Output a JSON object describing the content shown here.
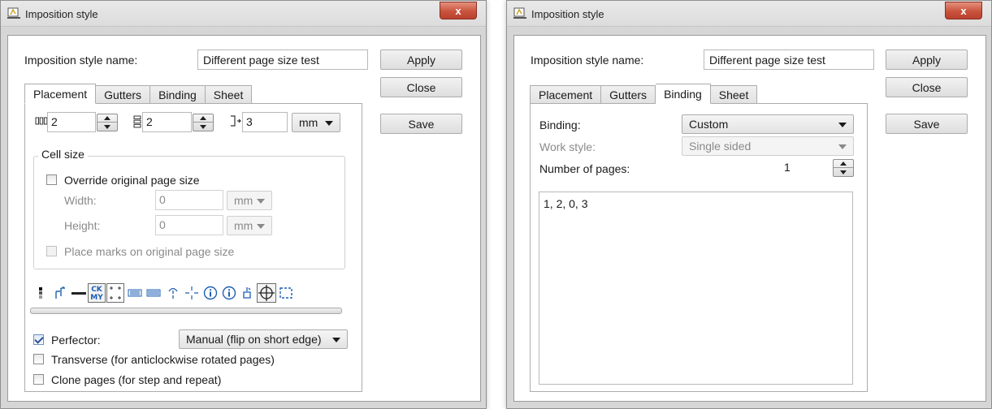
{
  "left_window": {
    "title": "Imposition style",
    "close_glyph": "x",
    "name_label": "Imposition style name:",
    "name_value": "Different page size test",
    "buttons": {
      "apply": "Apply",
      "close": "Close",
      "save": "Save"
    },
    "tabs": [
      "Placement",
      "Gutters",
      "Binding",
      "Sheet"
    ],
    "active_tab": "Placement",
    "placement": {
      "columns_value": "2",
      "rows_value": "2",
      "offset_value": "3",
      "unit": "mm",
      "cell_size": {
        "legend": "Cell size",
        "override_label": "Override original page size",
        "override_checked": false,
        "width_label": "Width:",
        "width_value": "0",
        "width_unit": "mm",
        "height_label": "Height:",
        "height_value": "0",
        "height_unit": "mm",
        "place_marks_label": "Place marks on original page size",
        "place_marks_checked": false
      },
      "mark_icons": [
        "color-bar-icon",
        "crop-marks-icon",
        "dash-line-icon",
        "cmyk-icon",
        "cut-marks-icon",
        "barcode-icon",
        "barcode-2-icon",
        "fold-mark-icon",
        "registration-cross-icon",
        "info-icon",
        "info-2-icon",
        "ink-drop-icon",
        "target-icon",
        "frame-icon"
      ],
      "cmyk_text": {
        "top": "CK",
        "bottom": "MY"
      },
      "perfector_label": "Perfector:",
      "perfector_checked": true,
      "perfector_mode": "Manual (flip on short edge)",
      "transverse_label": "Transverse (for anticlockwise rotated pages)",
      "transverse_checked": false,
      "clone_label": "Clone pages (for step and repeat)",
      "clone_checked": false
    }
  },
  "right_window": {
    "title": "Imposition style",
    "close_glyph": "x",
    "name_label": "Imposition style name:",
    "name_value": "Different page size test",
    "buttons": {
      "apply": "Apply",
      "close": "Close",
      "save": "Save"
    },
    "tabs": [
      "Placement",
      "Gutters",
      "Binding",
      "Sheet"
    ],
    "active_tab": "Binding",
    "binding": {
      "binding_label": "Binding:",
      "binding_value": "Custom",
      "work_style_label": "Work style:",
      "work_style_value": "Single sided",
      "pages_label": "Number of pages:",
      "pages_value": "1",
      "page_order": "1, 2, 0, 3"
    }
  },
  "colors": {
    "window_frame": "#d6d6d6",
    "close_button": "#c9533c",
    "checkbox_check": "#2b4f96",
    "disabled_text": "#8a8a8a"
  }
}
